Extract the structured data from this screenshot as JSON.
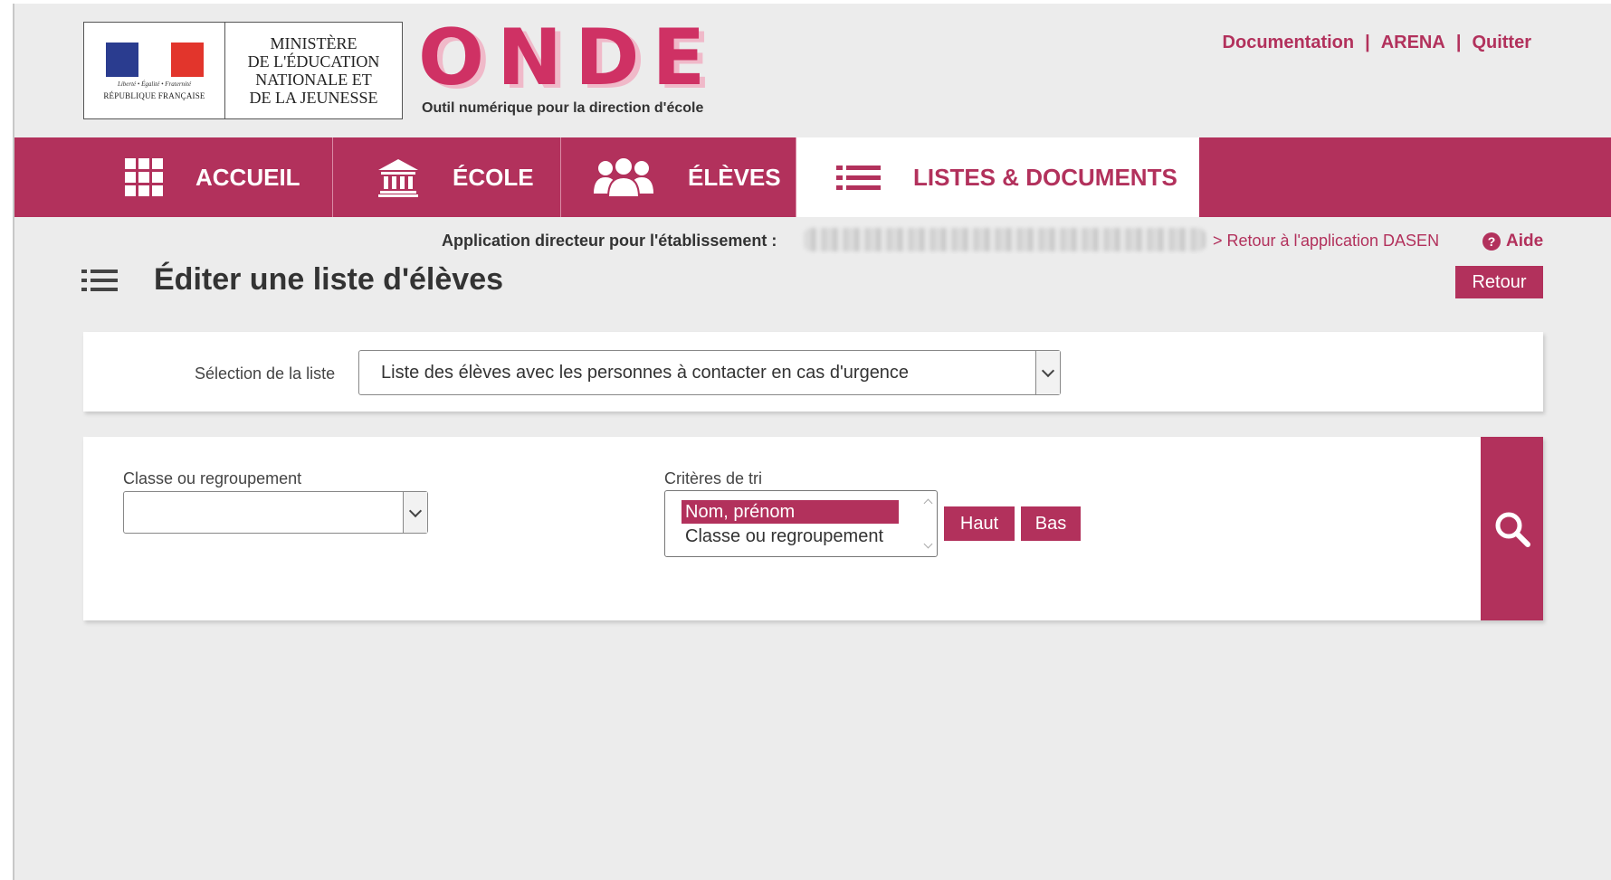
{
  "header": {
    "ministry": "MINISTÈRE\nDE L'ÉDUCATION\nNATIONALE ET\nDE LA JEUNESSE",
    "motto": "Liberté • Égalité • Fraternité",
    "republic": "RÉPUBLIQUE FRANÇAISE",
    "app_name": "ONDE",
    "app_subtitle": "Outil numérique pour la direction d'école",
    "links": [
      "Documentation",
      "ARENA",
      "Quitter"
    ],
    "separator": "|"
  },
  "nav": {
    "items": [
      {
        "label": "ACCUEIL",
        "icon": "grid-icon"
      },
      {
        "label": "ÉCOLE",
        "icon": "school-building-icon"
      },
      {
        "label": "ÉLÈVES",
        "icon": "students-group-icon"
      },
      {
        "label": "LISTES & DOCUMENTS",
        "icon": "list-icon",
        "active": true
      }
    ]
  },
  "context": {
    "app_line": "Application directeur pour l'établissement :",
    "back_link": "> Retour à l'application DASEN",
    "help": "Aide",
    "help_icon": "?"
  },
  "page": {
    "title": "Éditer une liste d'élèves",
    "retour": "Retour"
  },
  "selection": {
    "label": "Sélection de la liste",
    "value": "Liste des élèves avec les personnes à contacter en cas d'urgence"
  },
  "filters": {
    "classe_label": "Classe ou regroupement",
    "classe_value": "",
    "criteria_label": "Critères de tri",
    "criteria": [
      {
        "label": "Nom, prénom",
        "selected": true
      },
      {
        "label": "Classe ou regroupement",
        "selected": false
      }
    ],
    "up_label": "Haut",
    "down_label": "Bas"
  },
  "colors": {
    "brand": "#b2315c",
    "onde": "#cf3164",
    "background": "#ececec"
  }
}
